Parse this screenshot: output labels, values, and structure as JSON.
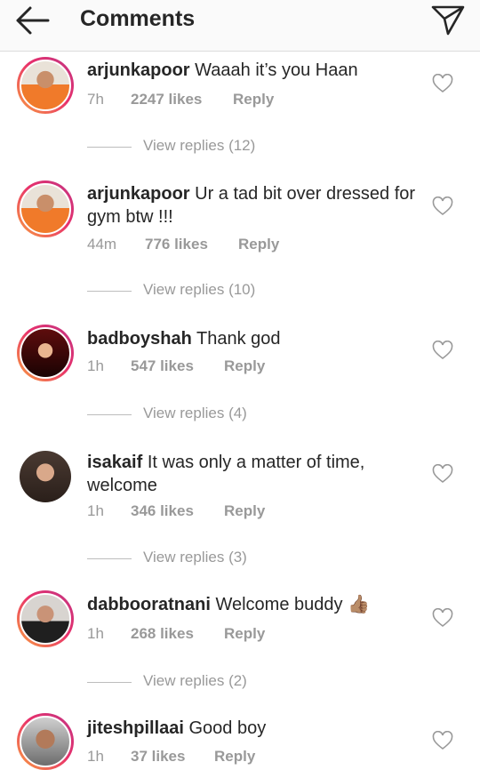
{
  "header": {
    "title": "Comments",
    "back_icon": "arrow-left-icon",
    "send_icon": "paper-plane-icon"
  },
  "comments": [
    {
      "username": "arjunkapoor",
      "text": "Waaah it’s you Haan",
      "time": "7h",
      "likes": "2247 likes",
      "reply": "Reply",
      "view_replies": "View replies (12)"
    },
    {
      "username": "arjunkapoor",
      "text": "Ur a tad bit over dressed for gym btw !!!",
      "time": "44m",
      "likes": "776 likes",
      "reply": "Reply",
      "view_replies": "View replies (10)"
    },
    {
      "username": "badboyshah",
      "text": "Thank god",
      "time": "1h",
      "likes": "547 likes",
      "reply": "Reply",
      "view_replies": "View replies (4)"
    },
    {
      "username": "isakaif",
      "text": "It was only a matter of time, welcome",
      "time": "1h",
      "likes": "346 likes",
      "reply": "Reply",
      "view_replies": "View replies (3)"
    },
    {
      "username": "dabbooratnani",
      "text": "Welcome buddy",
      "emoji": "👍🏽",
      "time": "1h",
      "likes": "268 likes",
      "reply": "Reply",
      "view_replies": "View replies (2)"
    },
    {
      "username": "jiteshpillaai",
      "text": "Good boy",
      "time": "1h",
      "likes": "37 likes",
      "reply": "Reply"
    }
  ]
}
